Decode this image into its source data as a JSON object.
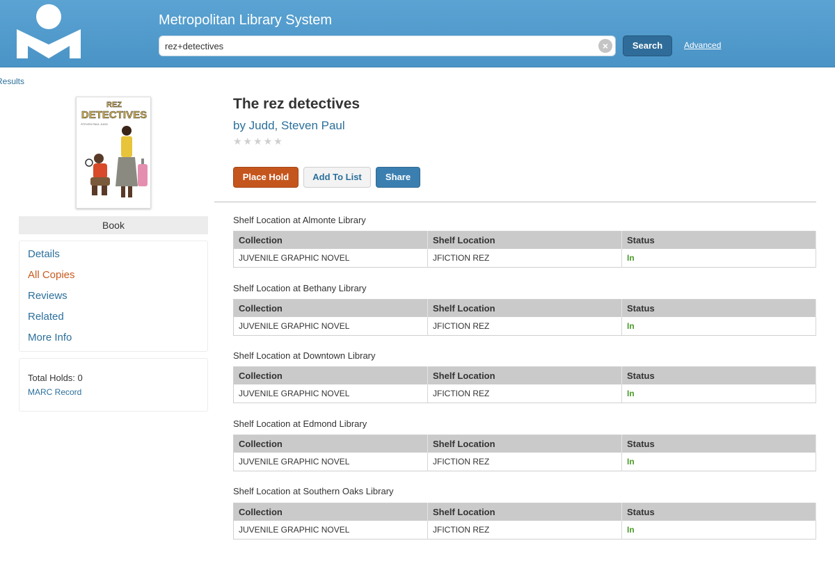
{
  "header": {
    "site_title": "Metropolitan Library System",
    "search_value": "rez+detectives",
    "search_button": "Search",
    "advanced_link": "Advanced"
  },
  "back_link": "Results",
  "cover": {
    "title_text": "REZ DETECTIVES",
    "small_print": "STEVEN PAUL JUDD"
  },
  "format": "Book",
  "nav": {
    "items": [
      {
        "label": "Details",
        "active": false
      },
      {
        "label": "All Copies",
        "active": true
      },
      {
        "label": "Reviews",
        "active": false
      },
      {
        "label": "Related",
        "active": false
      },
      {
        "label": "More Info",
        "active": false
      }
    ]
  },
  "info": {
    "total_holds": "Total Holds: 0",
    "marc_record": "MARC Record"
  },
  "item": {
    "title": "The rez detectives",
    "author": "by Judd, Steven Paul",
    "rating_stars": "★★★★★",
    "buttons": {
      "place_hold": "Place Hold",
      "add_to_list": "Add To List",
      "share": "Share"
    }
  },
  "columns": [
    "Collection",
    "Shelf Location",
    "Status"
  ],
  "locations": [
    {
      "heading": "Shelf Location at Almonte Library",
      "collection": "JUVENILE GRAPHIC NOVEL",
      "shelf": "JFICTION REZ",
      "status": "In"
    },
    {
      "heading": "Shelf Location at Bethany Library",
      "collection": "JUVENILE GRAPHIC NOVEL",
      "shelf": "JFICTION REZ",
      "status": "In"
    },
    {
      "heading": "Shelf Location at Downtown Library",
      "collection": "JUVENILE GRAPHIC NOVEL",
      "shelf": "JFICTION REZ",
      "status": "In"
    },
    {
      "heading": "Shelf Location at Edmond Library",
      "collection": "JUVENILE GRAPHIC NOVEL",
      "shelf": "JFICTION REZ",
      "status": "In"
    },
    {
      "heading": "Shelf Location at Southern Oaks Library",
      "collection": "JUVENILE GRAPHIC NOVEL",
      "shelf": "JFICTION REZ",
      "status": "In"
    }
  ]
}
